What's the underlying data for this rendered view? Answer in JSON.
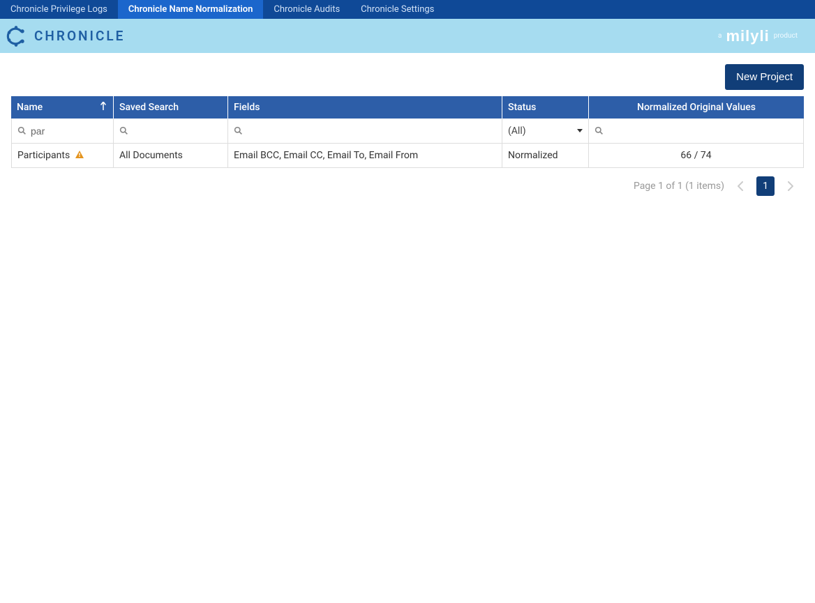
{
  "nav": {
    "tabs": [
      {
        "label": "Chronicle Privilege Logs",
        "active": false
      },
      {
        "label": "Chronicle Name Normalization",
        "active": true
      },
      {
        "label": "Chronicle Audits",
        "active": false
      },
      {
        "label": "Chronicle Settings",
        "active": false
      }
    ]
  },
  "brand": {
    "name": "CHRONICLE",
    "tagline_prefix": "a",
    "company": "milyli",
    "tagline_suffix": "product"
  },
  "toolbar": {
    "new_project_label": "New Project"
  },
  "table": {
    "headers": {
      "name": "Name",
      "saved_search": "Saved Search",
      "fields": "Fields",
      "status": "Status",
      "normalized": "Normalized Original Values"
    },
    "filters": {
      "name_value": "par",
      "status_value": "(All)"
    },
    "rows": [
      {
        "name": "Participants",
        "warning": true,
        "saved_search": "All Documents",
        "fields": "Email BCC, Email CC, Email To, Email From",
        "status": "Normalized",
        "normalized": "66 / 74"
      }
    ]
  },
  "pager": {
    "summary": "Page 1 of 1 (1 items)",
    "current_page": "1"
  }
}
